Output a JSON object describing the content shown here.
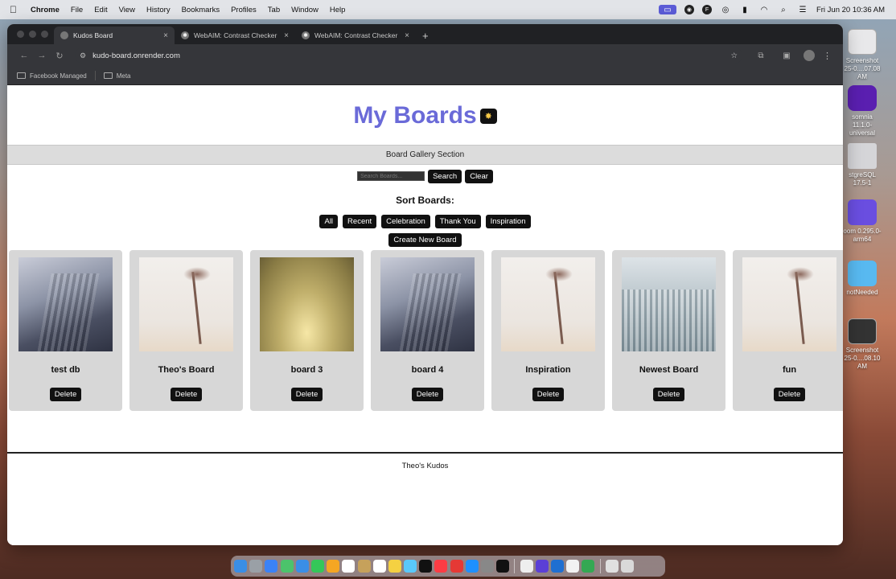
{
  "menubar": {
    "apple": "",
    "items": [
      "Chrome",
      "File",
      "Edit",
      "View",
      "History",
      "Bookmarks",
      "Profiles",
      "Tab",
      "Window",
      "Help"
    ],
    "clock": "Fri Jun 20  10:36 AM",
    "status_icons": [
      "screen-share-icon",
      "camera-icon",
      "font-icon",
      "sync-icon",
      "battery-icon",
      "wifi-icon",
      "search-icon",
      "control-center-icon"
    ]
  },
  "desktop": [
    {
      "label": "Screenshot\n25-0....07.08 AM",
      "color": "#e8e8ea"
    },
    {
      "label": "somnia 11.1.0-\nuniversal",
      "color": "#5a1fb0"
    },
    {
      "label": "stgreSQL 17.5-1",
      "color": "#d5d5d8"
    },
    {
      "label": "oom 0.295.0-\narm64",
      "color": "#6a4ee0"
    },
    {
      "label": "notNeeded",
      "color": "#58b9f0"
    },
    {
      "label": "Screenshot\n25-0....08.10 AM",
      "color": "#333"
    }
  ],
  "browser": {
    "tabs": [
      {
        "title": "Kudos Board"
      },
      {
        "title": "WebAIM: Contrast Checker"
      },
      {
        "title": "WebAIM: Contrast Checker"
      }
    ],
    "url": "kudo-board.onrender.com",
    "bookmarks": [
      {
        "label": "Facebook Managed"
      },
      {
        "label": "Meta"
      }
    ]
  },
  "page": {
    "title": "My Boards",
    "title_badge": "✸",
    "gallery_label": "Board Gallery Section",
    "search_placeholder": "Search Boards...",
    "search_button": "Search",
    "clear_button": "Clear",
    "sort_label": "Sort Boards:",
    "filters": [
      "All",
      "Recent",
      "Celebration",
      "Thank You",
      "Inspiration"
    ],
    "create_button": "Create New Board",
    "boards": [
      {
        "title": "test db",
        "image": "building",
        "delete": "Delete"
      },
      {
        "title": "Theo's Board",
        "image": "palm",
        "delete": "Delete"
      },
      {
        "title": "board 3",
        "image": "fog",
        "delete": "Delete"
      },
      {
        "title": "board 4",
        "image": "building",
        "delete": "Delete"
      },
      {
        "title": "Inspiration",
        "image": "palm",
        "delete": "Delete"
      },
      {
        "title": "Newest Board",
        "image": "snow",
        "delete": "Delete"
      },
      {
        "title": "fun",
        "image": "palm",
        "delete": "Delete"
      }
    ],
    "footer": "Theo's Kudos"
  },
  "dock": {
    "colors": [
      "#3a8ee6",
      "#9aa0a6",
      "#3b82f6",
      "#4cc36b",
      "#3a8ee6",
      "#34c759",
      "#f5a623",
      "#ffffff",
      "#c6a15b",
      "#ffffff",
      "#f5d142",
      "#5ac8fa",
      "#111111",
      "#fc3c44",
      "#e53935",
      "#1e90ff",
      "#888888",
      "#111111",
      "#eeeeee",
      "#5b3fd6",
      "#1f6fd1",
      "#f2f2f2",
      "#34a853",
      "#e0e0e0",
      "#d9d9d9"
    ]
  }
}
